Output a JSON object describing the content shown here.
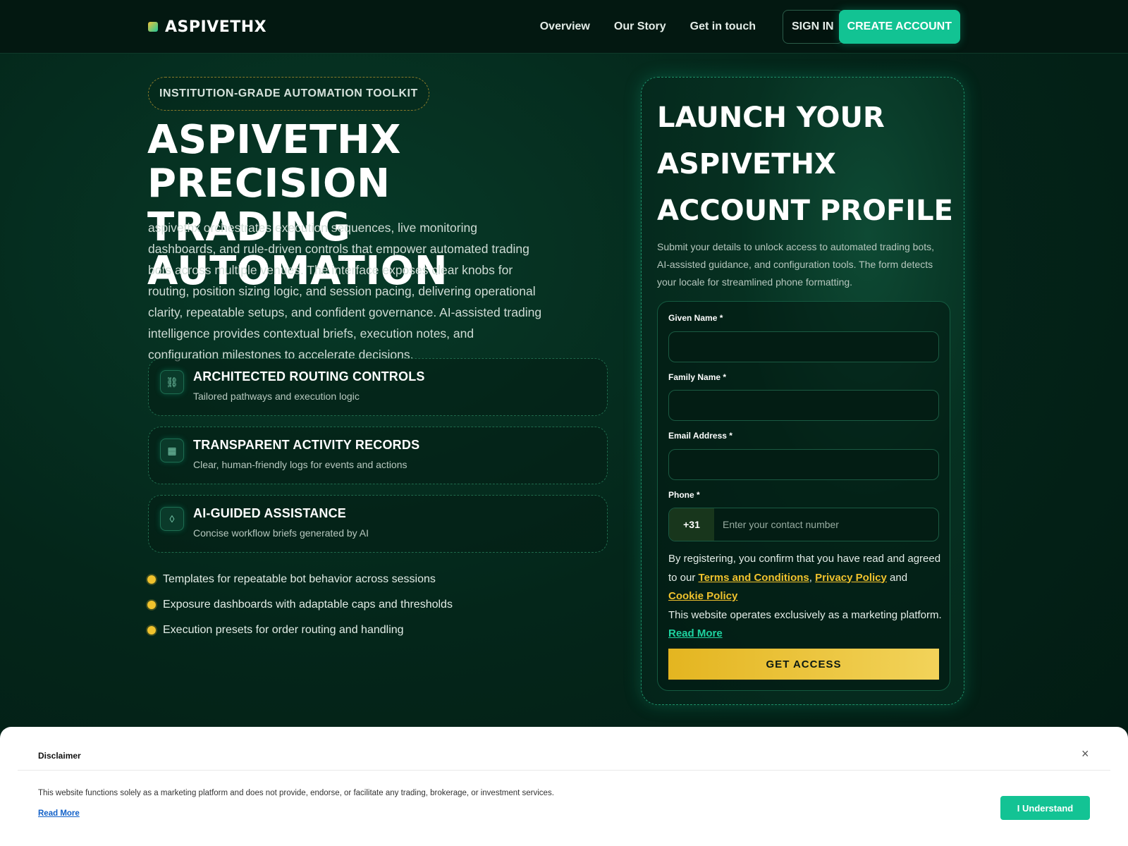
{
  "nav": {
    "brand": "ASPIVETHX",
    "links": [
      "Overview",
      "Our Story",
      "Get in touch"
    ],
    "sign_in": "SIGN IN",
    "create_account": "CREATE ACCOUNT"
  },
  "hero": {
    "badge": "INSTITUTION-GRADE AUTOMATION TOOLKIT",
    "title_line1": "ASPIVETHX PRECISION",
    "title_line2": "TRADING AUTOMATION",
    "text": "aspivethx orchestrates execution sequences, live monitoring dashboards, and rule-driven controls that empower automated trading bots across multiple venues. The interface exposes clear knobs for routing, position sizing logic, and session pacing, delivering operational clarity, repeatable setups, and confident governance. AI-assisted trading intelligence provides contextual briefs, execution notes, and configuration milestones to accelerate decisions."
  },
  "features": [
    {
      "icon": "routing-icon",
      "glyph": "⛓",
      "title": "ARCHITECTED ROUTING CONTROLS",
      "subtitle": "Tailored pathways and execution logic"
    },
    {
      "icon": "grid-icon",
      "glyph": "▦",
      "title": "TRANSPARENT ACTIVITY RECORDS",
      "subtitle": "Clear, human-friendly logs for events and actions"
    },
    {
      "icon": "diamond-icon",
      "glyph": "◊",
      "title": "AI-GUIDED ASSISTANCE",
      "subtitle": "Concise workflow briefs generated by AI"
    }
  ],
  "bullets": [
    "Templates for repeatable bot behavior across sessions",
    "Exposure dashboards with adaptable caps and thresholds",
    "Execution presets for order routing and handling"
  ],
  "panel": {
    "title": "LAUNCH YOUR ASPIVETHX ACCOUNT PROFILE",
    "text": "Submit your details to unlock access to automated trading bots, AI-assisted guidance, and configuration tools. The form detects your locale for streamlined phone formatting."
  },
  "form": {
    "given_name_label": "Given Name *",
    "given_name_value": "",
    "family_name_label": "Family Name *",
    "family_name_value": "",
    "email_label": "Email Address *",
    "email_value": "",
    "phone_label": "Phone *",
    "phone_code": "+31",
    "phone_placeholder": "Enter your contact number",
    "consent_prefix": "By registering, you confirm that you have read and agreed to our",
    "terms": "Terms and Conditions",
    "privacy": "Privacy Policy",
    "and": "and",
    "cookie": "Cookie Policy",
    "marketing_note": "This website operates exclusively as a marketing platform.",
    "read_more": "Read More",
    "submit": "GET ACCESS"
  },
  "disclaimer": {
    "title": "Disclaimer",
    "close": "×",
    "text": "This website functions solely as a marketing platform and does not provide, endorse, or facilitate any trading, brokerage, or investment services.",
    "read_more": "Read More",
    "button": "I Understand"
  },
  "colors": {
    "accent_green": "#12c393",
    "accent_gold": "#f0c22d",
    "background": "#04261a"
  }
}
